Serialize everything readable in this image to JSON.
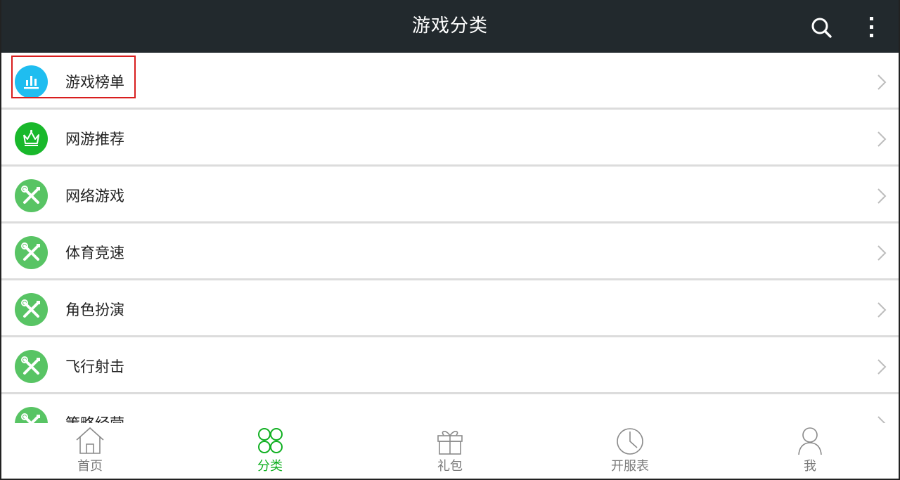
{
  "header": {
    "title": "游戏分类"
  },
  "categories": [
    {
      "label": "游戏榜单",
      "icon": "bar-chart-icon",
      "color": "#1fbdf0"
    },
    {
      "label": "网游推荐",
      "icon": "crown-icon",
      "color": "#19b82b"
    },
    {
      "label": "网络游戏",
      "icon": "tools-icon",
      "color": "#58c464"
    },
    {
      "label": "体育竞速",
      "icon": "tools-icon",
      "color": "#58c464"
    },
    {
      "label": "角色扮演",
      "icon": "tools-icon",
      "color": "#58c464"
    },
    {
      "label": "飞行射击",
      "icon": "tools-icon",
      "color": "#58c464"
    },
    {
      "label": "策略经营",
      "icon": "tools-icon",
      "color": "#58c464"
    }
  ],
  "bottom_nav": {
    "active_index": 1,
    "active_color": "#11b022",
    "inactive_color": "#7a7a7a",
    "tabs": [
      {
        "label": "首页",
        "icon": "home-icon"
      },
      {
        "label": "分类",
        "icon": "category-grid-icon"
      },
      {
        "label": "礼包",
        "icon": "gift-icon"
      },
      {
        "label": "开服表",
        "icon": "clock-icon"
      },
      {
        "label": "我",
        "icon": "user-icon"
      }
    ]
  }
}
